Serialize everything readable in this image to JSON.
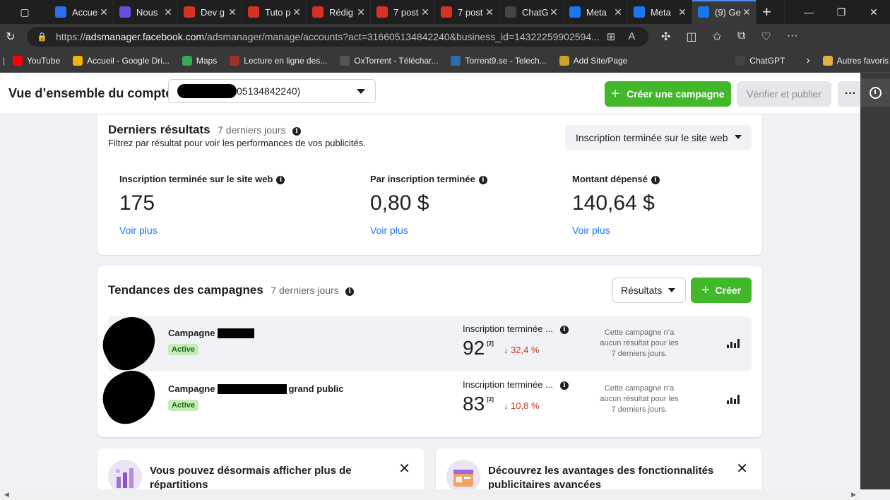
{
  "browser": {
    "tabs": [
      {
        "title": "Accue",
        "icon": "copilot-icon",
        "color": "#2b6ff2"
      },
      {
        "title": "Nous",
        "icon": "heart-shield-icon",
        "color": "#6c4ce0"
      },
      {
        "title": "Dev g",
        "icon": "pdf-icon",
        "color": "#d93025"
      },
      {
        "title": "Tuto p",
        "icon": "pdf-icon",
        "color": "#d93025"
      },
      {
        "title": "Rédig",
        "icon": "pdf-icon",
        "color": "#d93025"
      },
      {
        "title": "7 post",
        "icon": "pdf-icon",
        "color": "#d93025"
      },
      {
        "title": "7 post",
        "icon": "pdf-icon",
        "color": "#d93025"
      },
      {
        "title": "ChatG",
        "icon": "chatgpt-icon",
        "color": "#444444"
      },
      {
        "title": "Meta",
        "icon": "meta-icon",
        "color": "#1877f2"
      },
      {
        "title": "Meta",
        "icon": "meta-icon",
        "color": "#1877f2"
      },
      {
        "title": "(9) Ge",
        "icon": "meta-icon",
        "color": "#1877f2",
        "active": true
      }
    ],
    "url_prefix": "https://",
    "url_host": "adsmanager.facebook.com",
    "url_path": "/adsmanager/manage/accounts?act=316605134842240&business_id=14322259902594...",
    "bookmarks": [
      {
        "label": "YouTube",
        "color": "#ff0000"
      },
      {
        "label": "Accueil - Google Dri...",
        "color": "#f4b400"
      },
      {
        "label": "Maps",
        "color": "#34a853"
      },
      {
        "label": "Lecture en ligne des...",
        "color": "#a0302b"
      },
      {
        "label": "OxTorrent - Téléchar...",
        "color": "#555555"
      },
      {
        "label": "Torrent9.se - Telech...",
        "color": "#2b6cb0"
      },
      {
        "label": "Add Site/Page",
        "color": "#c9a227"
      },
      {
        "label": "ChatGPT",
        "color": "#444444"
      },
      {
        "label": "Autres favoris",
        "color": "#e0b040"
      }
    ]
  },
  "header": {
    "title": "Vue d’ensemble du compte",
    "account_suffix": "05134842240)",
    "create_campaign": "Créer une campagne",
    "verify_publish": "Vérifier et publier",
    "more": "···"
  },
  "results": {
    "title": "Derniers résultats",
    "period": "7 derniers jours",
    "description": "Filtrez par résultat pour voir les performances de vos publicités.",
    "filter": "Inscription terminée sur le site web",
    "metrics": [
      {
        "label": "Inscription terminée sur le site web",
        "value": "175",
        "link": "Voir plus"
      },
      {
        "label": "Par inscription terminée",
        "value": "0,80 $",
        "link": "Voir plus"
      },
      {
        "label": "Montant dépensé",
        "value": "140,64 $",
        "link": "Voir plus"
      }
    ]
  },
  "trends": {
    "title": "Tendances des campagnes",
    "period": "7 derniers jours",
    "dropdown": "Résultats",
    "create": "Créer",
    "campaigns": [
      {
        "name_prefix": "Campagne",
        "name_suffix": "",
        "status": "Active",
        "metric_label": "Inscription terminée ...",
        "value": "92",
        "note_ref": "[2]",
        "change": "↓ 32,4 %",
        "no_result": "Cette campagne n’a aucun résultat pour les 7 derniers jours."
      },
      {
        "name_prefix": "Campagne",
        "name_suffix": "grand public",
        "status": "Active",
        "metric_label": "Inscription terminée ...",
        "value": "83",
        "note_ref": "[2]",
        "change": "↓ 10,8 %",
        "no_result": "Cette campagne n’a aucun résultat pour les 7 derniers jours."
      }
    ]
  },
  "promos": [
    {
      "title": "Vous pouvez désormais afficher plus de répartitions",
      "close": "✕"
    },
    {
      "title": "Découvrez les avantages des fonctionnalités publicitaires avancées",
      "close": "✕"
    }
  ],
  "colors": {
    "accent_green": "#42b72a",
    "link_blue": "#1877f2",
    "decline_red": "#c0392b",
    "active_badge": "#c4ecb4"
  }
}
